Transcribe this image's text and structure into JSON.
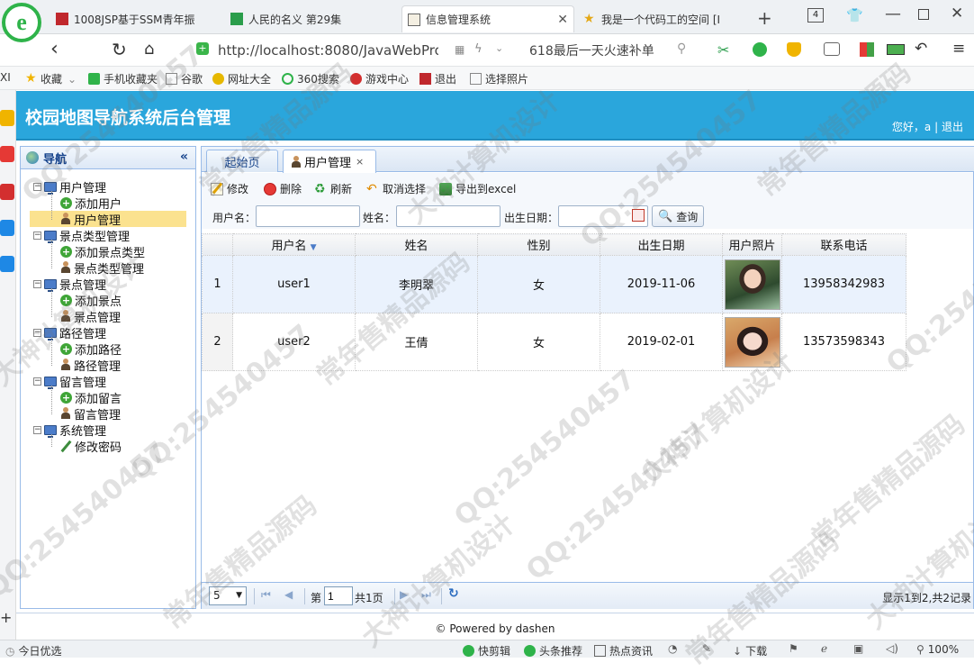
{
  "browser": {
    "tabs": [
      {
        "label": "1008JSP基于SSM青年振"
      },
      {
        "label": "人民的名义 第29集"
      },
      {
        "label": "信息管理系统"
      },
      {
        "label": "我是一个代码工的空间 [I"
      }
    ],
    "tab_count": "4",
    "url": "http://localhost:8080/JavaWebProje",
    "search_hint": "618最后一天火速补单",
    "bookmarks": [
      "收藏",
      "手机收藏夹",
      "谷歌",
      "网址大全",
      "360搜索",
      "游戏中心",
      "退出",
      "选择照片"
    ],
    "left_edge_text": "XI",
    "status": {
      "left": "今日优选",
      "items": [
        "快剪辑",
        "头条推荐",
        "热点资讯",
        "下载"
      ],
      "zoom": "100%"
    }
  },
  "app": {
    "title": "校园地图导航系统后台管理",
    "greeting": "您好，a",
    "sep": "|",
    "logout": "退出",
    "nav": {
      "title": "导航",
      "collapse": "«",
      "groups": [
        {
          "label": "用户管理",
          "children": [
            "添加用户",
            "用户管理"
          ]
        },
        {
          "label": "景点类型管理",
          "children": [
            "添加景点类型",
            "景点类型管理"
          ]
        },
        {
          "label": "景点管理",
          "children": [
            "添加景点",
            "景点管理"
          ]
        },
        {
          "label": "路径管理",
          "children": [
            "添加路径",
            "路径管理"
          ]
        },
        {
          "label": "留言管理",
          "children": [
            "添加留言",
            "留言管理"
          ]
        },
        {
          "label": "系统管理",
          "children": [
            "修改密码"
          ]
        }
      ]
    },
    "tabs": {
      "home": "起始页",
      "active": "用户管理",
      "close": "×"
    },
    "toolbar": {
      "edit": "修改",
      "delete": "删除",
      "refresh": "刷新",
      "cancel_select": "取消选择",
      "export": "导出到excel"
    },
    "filters": {
      "username_label": "用户名：",
      "name_label": "姓名：",
      "birth_label": "出生日期：",
      "search": "查询"
    },
    "grid": {
      "columns": [
        "",
        "用户名",
        "姓名",
        "性别",
        "出生日期",
        "用户照片",
        "联系电话"
      ],
      "sort_indicator": "▼",
      "rows": [
        {
          "no": "1",
          "username": "user1",
          "name": "李明翠",
          "gender": "女",
          "birth": "2019-11-06",
          "phone": "13958342983"
        },
        {
          "no": "2",
          "username": "user2",
          "name": "王倩",
          "gender": "女",
          "birth": "2019-02-01",
          "phone": "13573598343"
        }
      ]
    },
    "pager": {
      "page_size": "5",
      "page_prefix": "第",
      "page_value": "1",
      "page_total": "共1页",
      "summary": "显示1到2,共2记录"
    },
    "footer": "© Powered by dashen"
  },
  "watermarks": [
    "QQ:254540457",
    "常年售精品源码",
    "大神计算机设计"
  ],
  "colors": {
    "header": "#2aa6dc",
    "panel_border": "#99bbe8",
    "selected": "#fbe28f"
  }
}
